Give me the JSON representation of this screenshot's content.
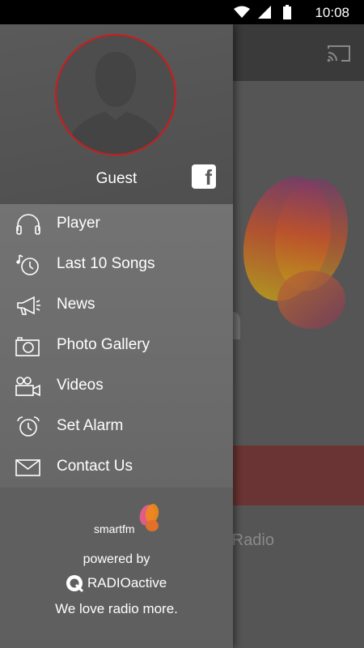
{
  "status_bar": {
    "time": "10:08"
  },
  "background": {
    "brand_partial_letter": "n",
    "radio_text_partial": "n Radio"
  },
  "drawer": {
    "user": {
      "name": "Guest"
    },
    "facebook_glyph": "f",
    "menu": [
      {
        "label": "Player",
        "icon": "headphones-icon"
      },
      {
        "label": "Last 10 Songs",
        "icon": "music-clock-icon"
      },
      {
        "label": "News",
        "icon": "megaphone-icon"
      },
      {
        "label": "Photo Gallery",
        "icon": "camera-icon"
      },
      {
        "label": "Videos",
        "icon": "video-camera-icon"
      },
      {
        "label": "Set Alarm",
        "icon": "alarm-clock-icon"
      },
      {
        "label": "Contact Us",
        "icon": "envelope-icon"
      }
    ],
    "footer": {
      "logo_text": "smartfm",
      "powered_by": "powered by",
      "radioactive": "RADIOactive",
      "tagline": "We love radio more."
    }
  },
  "colors": {
    "avatar_ring": "#d01a1a",
    "brand_orange": "#f08a1a",
    "brand_purple": "#8a3a8a"
  }
}
